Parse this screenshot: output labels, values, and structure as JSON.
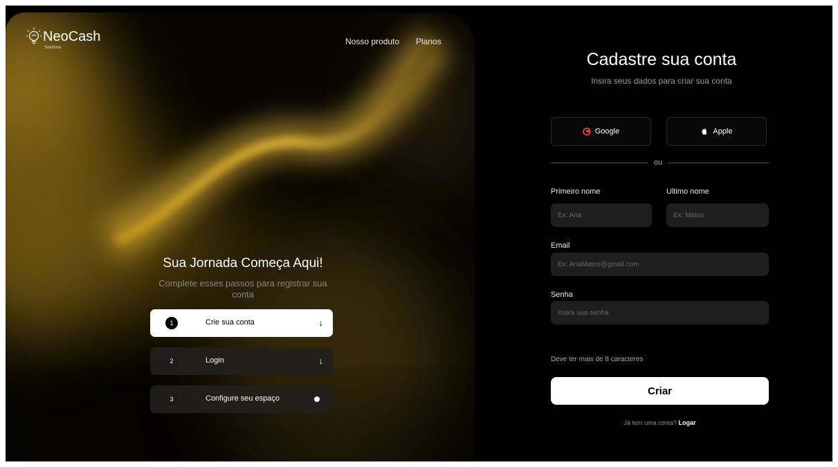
{
  "brand": {
    "name": "NeoCash",
    "tagline": "Solutions"
  },
  "nav": {
    "product": "Nosso produto",
    "plans": "Planos"
  },
  "hero": {
    "title": "Sua Jornada Começa Aqui!",
    "subtitle": "Complete esses passos para registrar sua conta",
    "steps": [
      {
        "number": "1",
        "label": "Crie sua conta",
        "indicator": "arrow-down-icon",
        "active": true
      },
      {
        "number": "2",
        "label": "Login",
        "indicator": "arrow-down-icon",
        "active": false
      },
      {
        "number": "3",
        "label": "Configure seu espaço",
        "indicator": "dot-icon",
        "active": false
      }
    ]
  },
  "form": {
    "title": "Cadastre sua conta",
    "subtitle": "Insira seus dados para criar sua conta",
    "google_label": "Google",
    "apple_label": "Apple",
    "divider_text": "ou",
    "first_name": {
      "label": "Primeiro nome",
      "placeholder": "Ex: Ana",
      "value": ""
    },
    "last_name": {
      "label": "Ultimo nome",
      "placeholder": "Ex: Matos",
      "value": ""
    },
    "email": {
      "label": "Email",
      "placeholder": "Ex: AnaMatos@gmail.com",
      "value": ""
    },
    "password": {
      "label": "Senha",
      "placeholder": "Insira sua senha",
      "value": ""
    },
    "hint": "Deve ter mais de 8 caracteres",
    "submit_label": "Criar",
    "login_question": "Já tem uma conta?",
    "login_link": "Logar"
  },
  "colors": {
    "accent_gold": "#d9a92a",
    "background": "#000000",
    "panel": "#1e1e1e",
    "google_red": "#ea4335"
  }
}
